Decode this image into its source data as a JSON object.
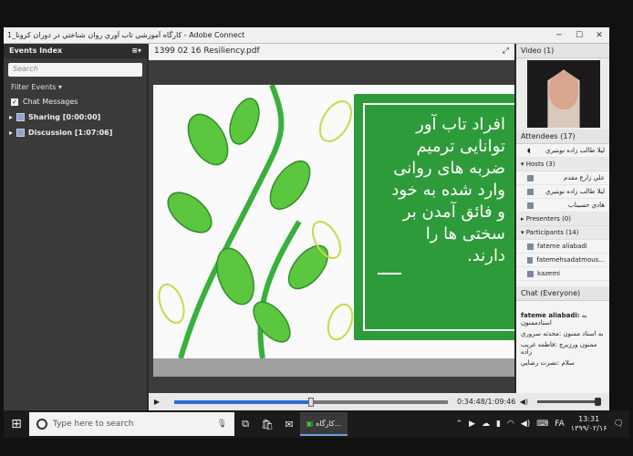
{
  "window": {
    "title": "كارگاه آموزشي تاب آوري روان شناختي در دوران كرونا_1 - Adobe Connect"
  },
  "events": {
    "header": "Events Index",
    "menu_glyph": "≡▾",
    "search_placeholder": "Search",
    "filter_label": "Filter Events ▾",
    "chat_checkbox_label": "Chat Messages",
    "items": [
      {
        "label": "Sharing [0:00:00]"
      },
      {
        "label": "Discussion [1:07:06]"
      }
    ]
  },
  "share": {
    "file_name": "1399 02 16 Resiliency.pdf",
    "slide_lines": [
      "افراد تاب آور",
      "توانایی ترمیم",
      "ضربه های روانی",
      "وارد شده به خود",
      "و فائق آمدن بر",
      "سختی ها را",
      "دارند."
    ]
  },
  "playback": {
    "time": "0:34:48/1:09:46",
    "progress": 0.5
  },
  "video": {
    "header": "Video",
    "count": "(1)"
  },
  "attendees": {
    "header": "Attendees",
    "count": "(17)",
    "presenter": "ليلا طالب زاده نوبتيري",
    "hosts_label": "Hosts (3)",
    "hosts": [
      "علي زارع مقدم",
      "ليلا طالب زاده نوبتيري",
      "هادي حسيناب"
    ],
    "presenters_label": "Presenters (0)",
    "participants_label": "Participants (14)",
    "participants": [
      "fateme aliabadi",
      "fatemehsadatmous...",
      "kazemi"
    ]
  },
  "chat": {
    "header": "Chat",
    "scope": "(Everyone)",
    "lines": [
      {
        "author": "fateme aliabadi:",
        "text": "به استادممنون"
      },
      {
        "author": "",
        "text": "به استاد ممنون :محدثه سروري"
      },
      {
        "author": "",
        "text": "ممنون ورزیرچ :فاطمه غريب زاده"
      },
      {
        "author": "",
        "text": "سلام :نصرت رضايي"
      }
    ]
  },
  "taskbar": {
    "search_placeholder": "Type here to search",
    "app_label": "كارگاه...",
    "lang": "FA",
    "time": "13:31",
    "date": "۱۳۹۹/۰۲/۱۶"
  },
  "colors": {
    "slide_green": "#2e9b3a",
    "progress_blue": "#2a6fd1"
  }
}
